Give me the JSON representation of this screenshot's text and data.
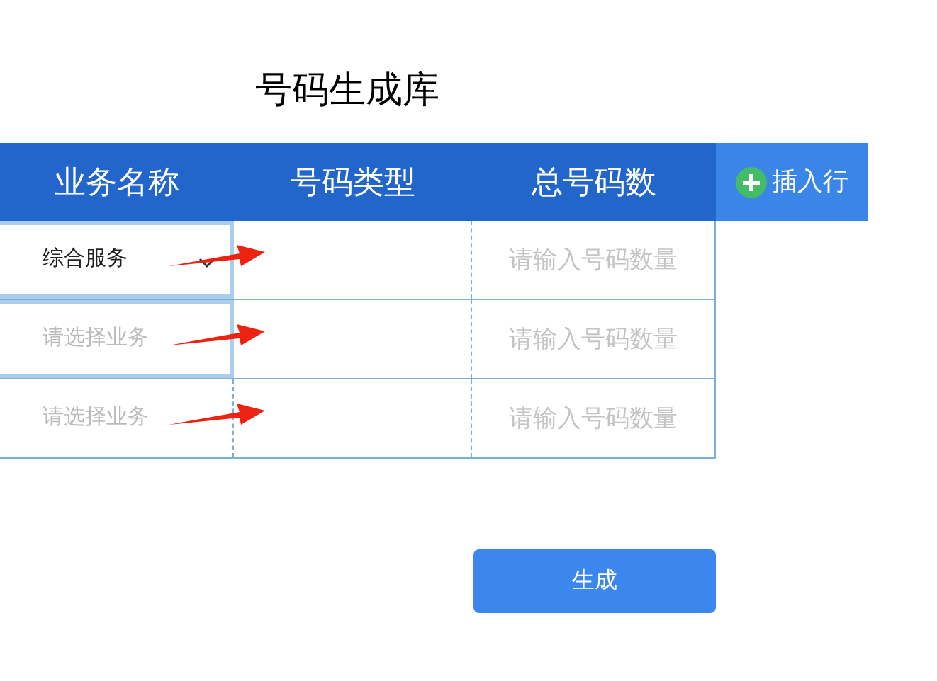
{
  "title": "号码生成库",
  "columns": [
    "业务名称",
    "号码类型",
    "总号码数"
  ],
  "insert_button": {
    "label": "插入行"
  },
  "rows": [
    {
      "business": {
        "value": "综合服务"
      },
      "focused": true,
      "hovered": true,
      "count": {
        "placeholder": "请输入号码数量"
      }
    },
    {
      "business": {
        "placeholder": "请选择业务"
      },
      "focused": true,
      "hovered": false,
      "count": {
        "placeholder": "请输入号码数量"
      }
    },
    {
      "business": {
        "placeholder": "请选择业务"
      },
      "focused": false,
      "hovered": false,
      "count": {
        "placeholder": "请输入号码数量"
      }
    }
  ],
  "generate_button": "生成"
}
